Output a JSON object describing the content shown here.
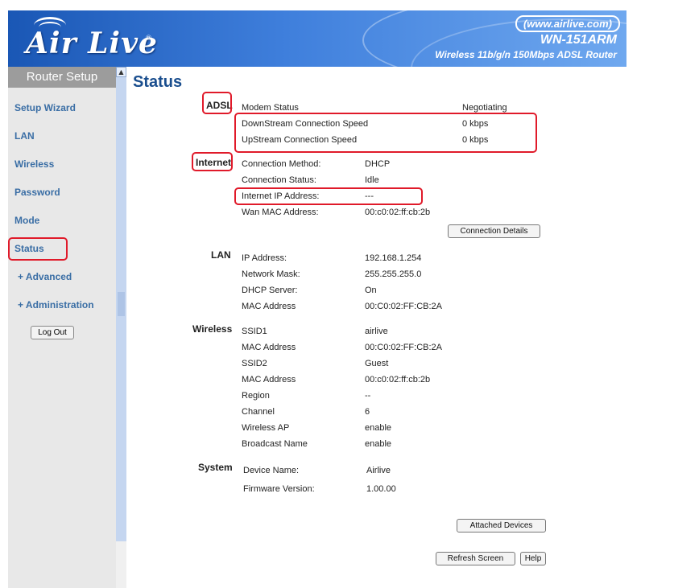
{
  "header": {
    "logo_text": "Air Live",
    "logo_reg": "®",
    "url": "(www.airlive.com)",
    "model": "WN-151ARM",
    "subtitle": "Wireless 11b/g/n 150Mbps ADSL Router"
  },
  "sidebar": {
    "title": "Router Setup",
    "items": [
      {
        "label": "Setup Wizard"
      },
      {
        "label": "LAN"
      },
      {
        "label": "Wireless"
      },
      {
        "label": "Password"
      },
      {
        "label": "Mode"
      },
      {
        "label": "Status"
      },
      {
        "label": "+ Advanced"
      },
      {
        "label": "+ Administration"
      }
    ],
    "logout_label": "Log Out"
  },
  "page": {
    "title": "Status"
  },
  "adsl": {
    "heading": "ADSL",
    "rows": [
      {
        "label": "Modem Status",
        "value": "Negotiating"
      },
      {
        "label": "DownStream Connection Speed",
        "value": "0 kbps"
      },
      {
        "label": "UpStream Connection Speed",
        "value": "0 kbps"
      }
    ]
  },
  "internet": {
    "heading": "Internet",
    "rows": [
      {
        "label": "Connection Method:",
        "value": "DHCP"
      },
      {
        "label": "Connection Status:",
        "value": "Idle"
      },
      {
        "label": "Internet IP Address:",
        "value": "---"
      },
      {
        "label": "Wan MAC Address:",
        "value": "00:c0:02:ff:cb:2b"
      }
    ],
    "details_button": "Connection Details"
  },
  "lan": {
    "heading": "LAN",
    "rows": [
      {
        "label": "IP Address:",
        "value": "192.168.1.254"
      },
      {
        "label": "Network Mask:",
        "value": "255.255.255.0"
      },
      {
        "label": "DHCP Server:",
        "value": "On"
      },
      {
        "label": "MAC Address",
        "value": "00:C0:02:FF:CB:2A"
      }
    ]
  },
  "wireless": {
    "heading": "Wireless",
    "rows": [
      {
        "label": "SSID1",
        "value": "airlive"
      },
      {
        "label": "MAC Address",
        "value": "00:C0:02:FF:CB:2A"
      },
      {
        "label": "SSID2",
        "value": "Guest"
      },
      {
        "label": "MAC Address",
        "value": "00:c0:02:ff:cb:2b"
      },
      {
        "label": "Region",
        "value": "--"
      },
      {
        "label": "Channel",
        "value": "6"
      },
      {
        "label": "Wireless AP",
        "value": "enable"
      },
      {
        "label": "Broadcast Name",
        "value": "enable"
      }
    ]
  },
  "system": {
    "heading": "System",
    "rows": [
      {
        "label": "Device Name:",
        "value": "Airlive"
      },
      {
        "label": "Firmware Version:",
        "value": "1.00.00"
      }
    ]
  },
  "buttons": {
    "attached_devices": "Attached Devices",
    "refresh": "Refresh Screen",
    "help": "Help"
  },
  "colors": {
    "highlight": "#e01a2a",
    "header_blue": "#1a57b5",
    "nav_link": "#3a6ea5"
  }
}
